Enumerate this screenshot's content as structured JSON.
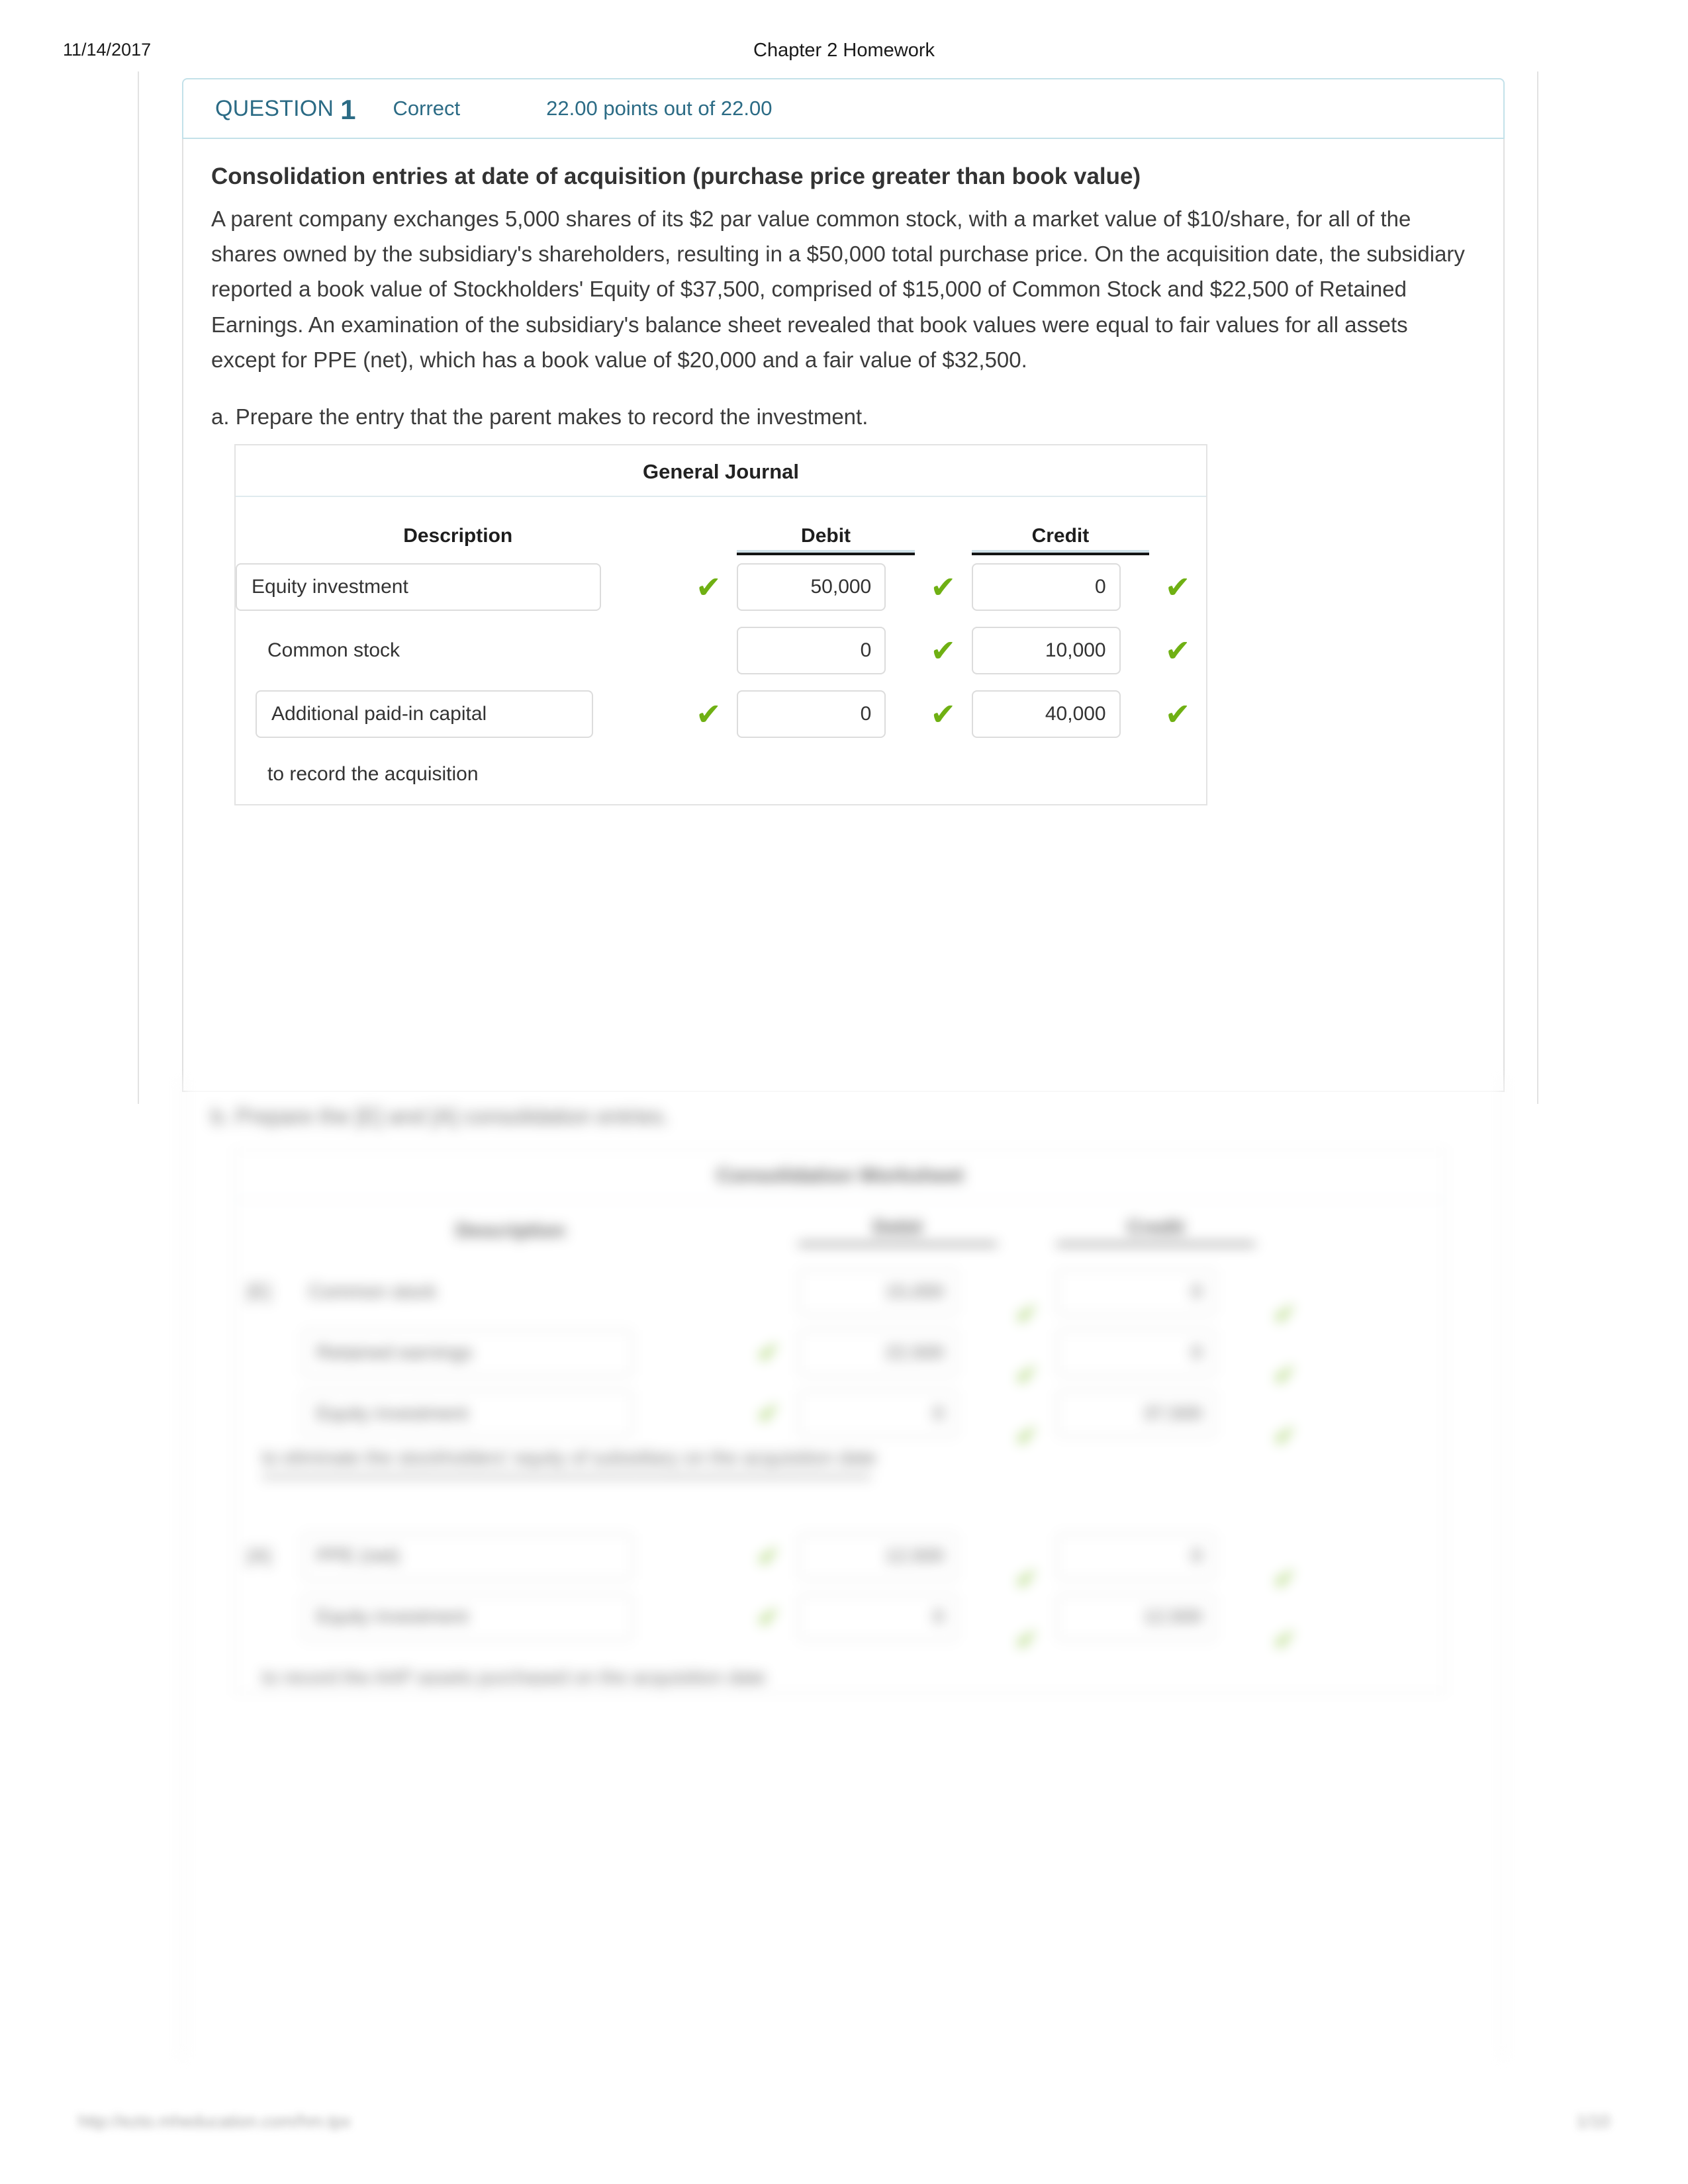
{
  "print_header": {
    "date": "11/14/2017",
    "title": "Chapter 2 Homework"
  },
  "question": {
    "label": "QUESTION",
    "number": "1",
    "status": "Correct",
    "points": "22.00 points out of 22.00",
    "accent_color": "#2b6b85",
    "header_border_color": "#c3e1e9"
  },
  "prompt": {
    "title": "Consolidation entries at date of acquisition (purchase price greater than book value)",
    "body": "A parent company exchanges 5,000 shares of its $2 par value common stock, with a market value of $10/share, for all of the shares owned by the subsidiary's shareholders, resulting in a $50,000 total purchase price. On the acquisition date, the subsidiary reported a book value of Stockholders' Equity of $37,500, comprised of $15,000 of Common Stock and $22,500 of Retained Earnings. An examination of the subsidiary's balance sheet revealed that book values were equal to fair values for all assets except for PPE (net), which has a book value of $20,000 and a fair value of $32,500.",
    "part_a": "a. Prepare the entry that the parent makes to record the investment."
  },
  "journal": {
    "title": "General Journal",
    "columns": {
      "description": "Description",
      "debit": "Debit",
      "credit": "Credit"
    },
    "rows": [
      {
        "description": "Equity investment",
        "desc_is_input": true,
        "desc_indent": false,
        "desc_correct": true,
        "debit": "50,000",
        "debit_correct": true,
        "credit": "0",
        "credit_correct": true
      },
      {
        "description": "Common stock",
        "desc_is_input": false,
        "desc_indent": true,
        "desc_correct": false,
        "debit": "0",
        "debit_correct": true,
        "credit": "10,000",
        "credit_correct": true
      },
      {
        "description": "Additional paid-in capital",
        "desc_is_input": true,
        "desc_indent": true,
        "desc_correct": true,
        "debit": "0",
        "debit_correct": true,
        "credit": "40,000",
        "credit_correct": true
      }
    ],
    "footer_note": "to record the acquisition",
    "check_glyph": "✔",
    "check_color": "#6fb013"
  },
  "blurred_section": {
    "part_b": "b. Prepare the [E] and [A] consolidation entries.",
    "table_title": "Consolidation Worksheet",
    "columns": {
      "description": "Description",
      "debit": "Debit",
      "credit": "Credit"
    },
    "rows": [
      {
        "tag": "[E]",
        "description": "Common stock",
        "desc_is_input": false,
        "debit": "15,000",
        "credit": "0"
      },
      {
        "tag": "",
        "description": "Retained earnings",
        "desc_is_input": true,
        "debit": "22,500",
        "credit": "0"
      },
      {
        "tag": "",
        "description": "Equity investment",
        "desc_is_input": true,
        "debit": "0",
        "credit": "37,500"
      }
    ],
    "note_e": "to eliminate the stockholders' equity of subsidiary on the acquisition date",
    "rows2": [
      {
        "tag": "[A]",
        "description": "PPE (net)",
        "desc_is_input": true,
        "debit": "12,500",
        "credit": "0"
      },
      {
        "tag": "",
        "description": "Equity investment",
        "desc_is_input": true,
        "debit": "0",
        "credit": "12,500"
      }
    ],
    "note_a": "to record the AAP assets purchased on the acquisition date",
    "check_glyph": "✔",
    "check_color": "#8cc63f"
  },
  "print_footer": {
    "url": "http://ezto.mheducation.com/hm.tpx",
    "page": "1/10"
  }
}
